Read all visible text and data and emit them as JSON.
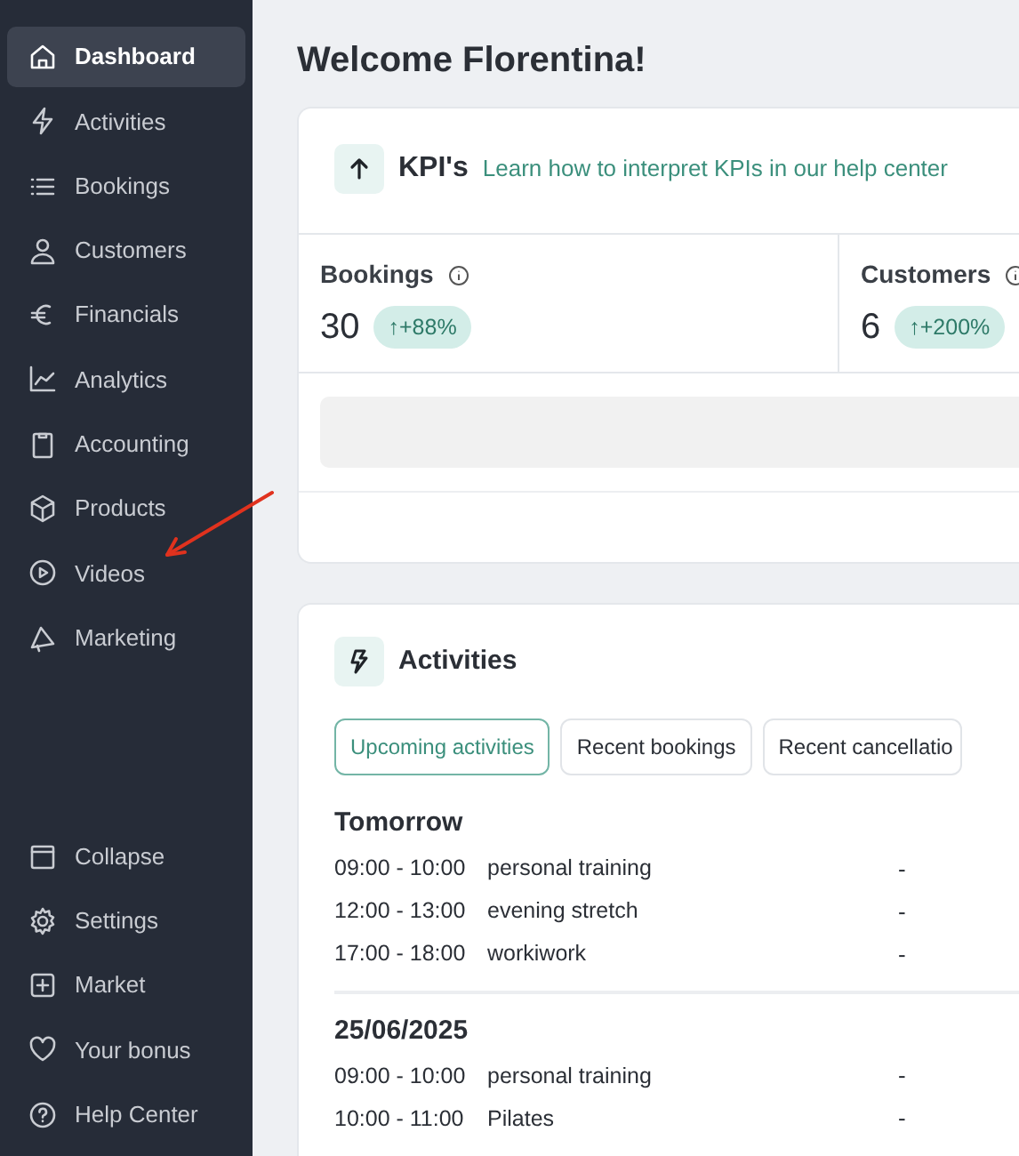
{
  "sidebar": {
    "items": [
      {
        "label": "Dashboard",
        "selected": true
      },
      {
        "label": "Activities",
        "selected": false
      },
      {
        "label": "Bookings",
        "selected": false
      },
      {
        "label": "Customers",
        "selected": false
      },
      {
        "label": "Financials",
        "selected": false
      },
      {
        "label": "Analytics",
        "selected": false
      },
      {
        "label": "Accounting",
        "selected": false
      },
      {
        "label": "Products",
        "selected": false
      },
      {
        "label": "Videos",
        "selected": false
      },
      {
        "label": "Marketing",
        "selected": false
      }
    ],
    "bottom_items": [
      {
        "label": "Collapse"
      },
      {
        "label": "Settings"
      },
      {
        "label": "Market"
      },
      {
        "label": "Your bonus"
      },
      {
        "label": "Help Center"
      }
    ]
  },
  "title": "Welcome Florentina!",
  "kpi_card": {
    "title": "KPI's",
    "link": "Learn how to interpret KPIs in our help center",
    "stats": [
      {
        "label": "Bookings",
        "value": "30",
        "change": "↑+88%"
      },
      {
        "label": "Customers",
        "value": "6",
        "change": "↑+200%"
      }
    ]
  },
  "activities_card": {
    "title": "Activities",
    "tabs": [
      {
        "label": "Upcoming activities",
        "selected": true
      },
      {
        "label": "Recent bookings",
        "selected": false
      },
      {
        "label": "Recent cancellatio",
        "selected": false
      }
    ],
    "groups": [
      {
        "date": "Tomorrow",
        "rows": [
          {
            "time": "09:00 - 10:00",
            "name": "personal training",
            "column_3": "-"
          },
          {
            "time": "12:00 - 13:00",
            "name": "evening stretch",
            "column_3": "-"
          },
          {
            "time": "17:00 - 18:00",
            "name": "workiwork",
            "column_3": "-"
          }
        ]
      },
      {
        "date": "25/06/2025",
        "rows": [
          {
            "time": "09:00 - 10:00",
            "name": "personal training",
            "column_3": "-"
          },
          {
            "time": "10:00 - 11:00",
            "name": "Pilates",
            "column_3": "-"
          }
        ]
      }
    ]
  }
}
